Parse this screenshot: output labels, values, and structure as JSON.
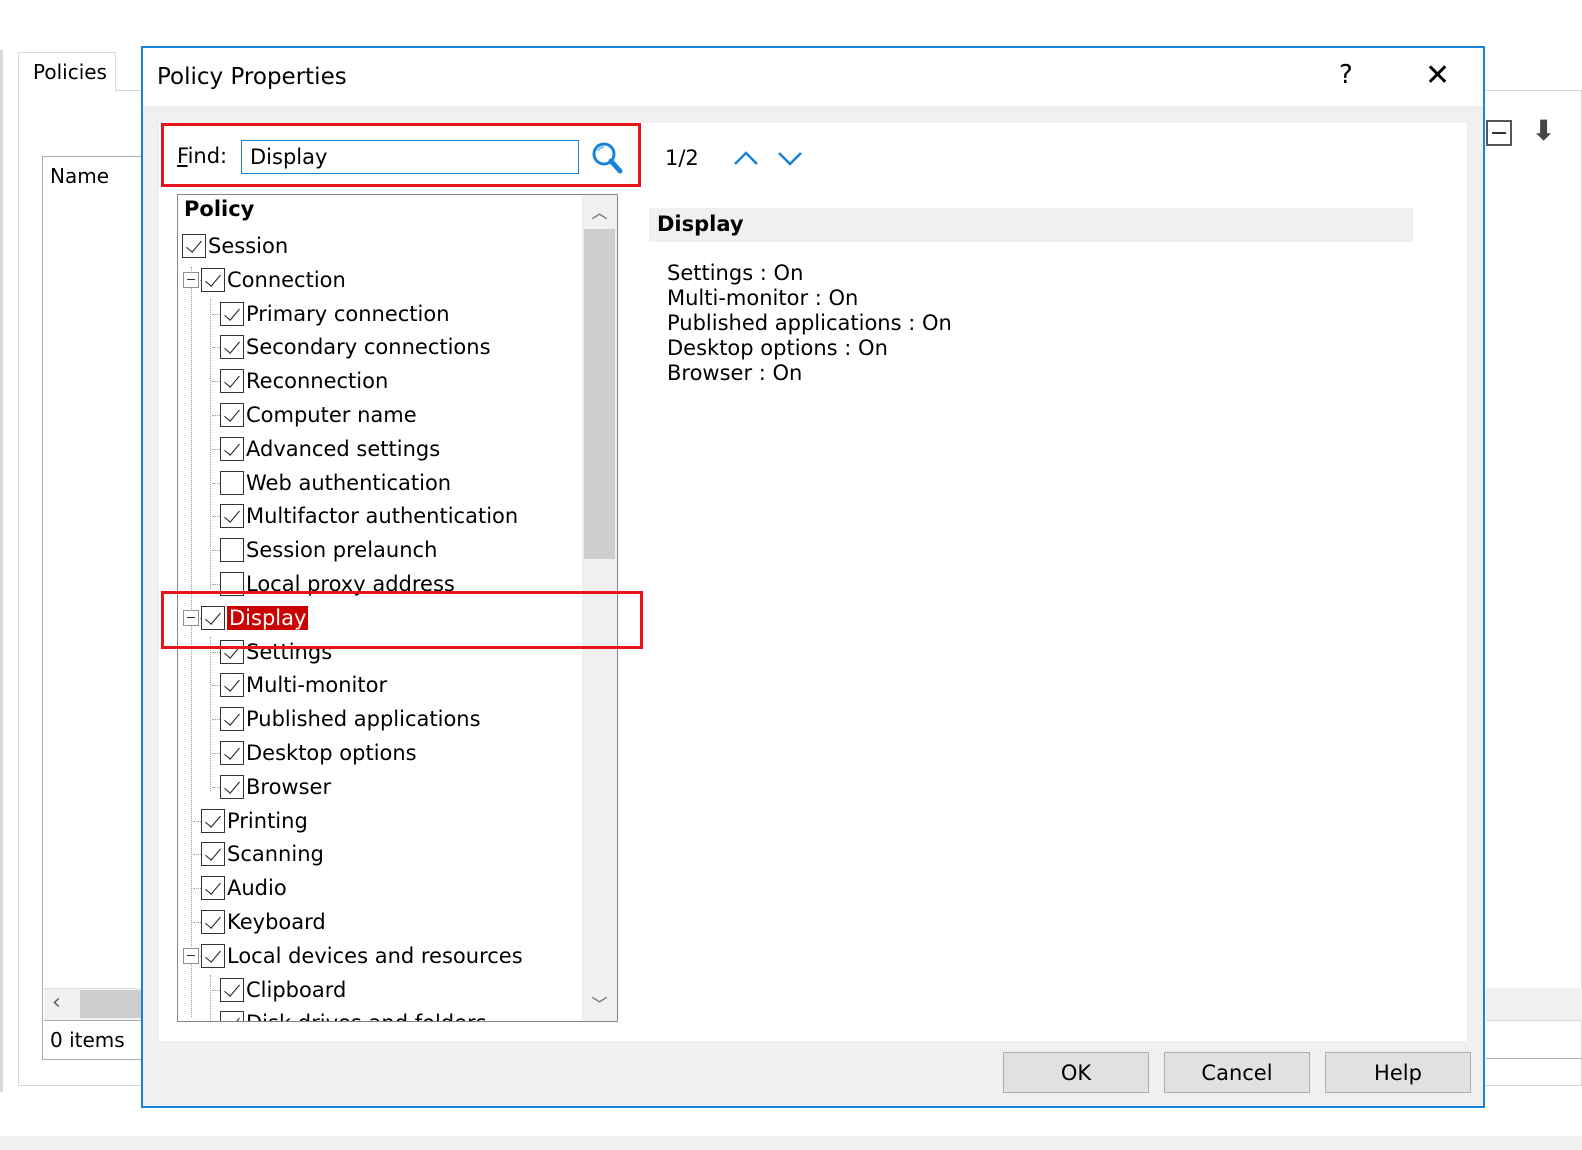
{
  "background": {
    "tab_label": "Policies",
    "column_header": "Name",
    "status": "0 items"
  },
  "dialog": {
    "title": "Policy Properties",
    "help_glyph": "?",
    "close_glyph": "✕"
  },
  "find": {
    "label_accel": "F",
    "label_rest": "ind:",
    "value": "Display",
    "counter": "1/2"
  },
  "tree": {
    "header": "Policy",
    "nodes": [
      {
        "label": "Session",
        "checked": true
      },
      {
        "label": "Connection",
        "checked": true
      },
      {
        "label": "Primary connection",
        "checked": true
      },
      {
        "label": "Secondary connections",
        "checked": true
      },
      {
        "label": "Reconnection",
        "checked": true
      },
      {
        "label": "Computer name",
        "checked": true
      },
      {
        "label": "Advanced settings",
        "checked": true
      },
      {
        "label": "Web authentication",
        "checked": false
      },
      {
        "label": "Multifactor authentication",
        "checked": true
      },
      {
        "label": "Session prelaunch",
        "checked": false
      },
      {
        "label": "Local proxy address",
        "checked": false
      },
      {
        "label": "Display",
        "checked": true,
        "selected": true
      },
      {
        "label": "Settings",
        "checked": true
      },
      {
        "label": "Multi-monitor",
        "checked": true
      },
      {
        "label": "Published applications",
        "checked": true
      },
      {
        "label": "Desktop options",
        "checked": true
      },
      {
        "label": "Browser",
        "checked": true
      },
      {
        "label": "Printing",
        "checked": true
      },
      {
        "label": "Scanning",
        "checked": true
      },
      {
        "label": "Audio",
        "checked": true
      },
      {
        "label": "Keyboard",
        "checked": true
      },
      {
        "label": "Local devices and resources",
        "checked": true
      },
      {
        "label": "Clipboard",
        "checked": true
      },
      {
        "label": "Disk drives and folders",
        "checked": true
      }
    ]
  },
  "detail": {
    "heading": "Display",
    "lines": [
      "Settings : On",
      "Multi-monitor : On",
      "Published applications : On",
      "Desktop options : On",
      "Browser : On"
    ]
  },
  "buttons": {
    "ok": "OK",
    "cancel": "Cancel",
    "help": "Help"
  },
  "colors": {
    "accent": "#1883d7",
    "highlight": "#e8141c",
    "selection": "#cc0000"
  }
}
